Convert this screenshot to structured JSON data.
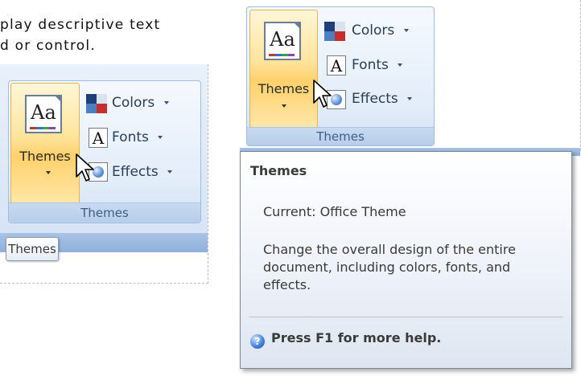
{
  "doc_text": {
    "line1": "play descriptive text",
    "line2": "d or control."
  },
  "ribbon": {
    "group_label": "Themes",
    "themes_button": "Themes",
    "colors": "Colors",
    "fonts": "Fonts",
    "effects": "Effects",
    "fonts_icon_letter": "A",
    "aa_text": "Aa"
  },
  "mini_tooltip": {
    "text": "Themes"
  },
  "tooltip": {
    "title": "Themes",
    "current": "Current: Office Theme",
    "description": "Change the overall design of the entire document, including colors, fonts, and effects.",
    "help": "Press F1 for more help.",
    "help_icon_glyph": "?"
  },
  "colors": {
    "ribbon_gradient_top": "#f5f9fe",
    "group_border": "#9fbddf",
    "hover_gold": "#ffd06b",
    "label_blue": "#3d5f86"
  },
  "icons": [
    "colors-icon",
    "fonts-icon",
    "effects-icon",
    "themes-aa-icon",
    "help-icon",
    "cursor-icon",
    "dropdown-arrow-icon"
  ]
}
